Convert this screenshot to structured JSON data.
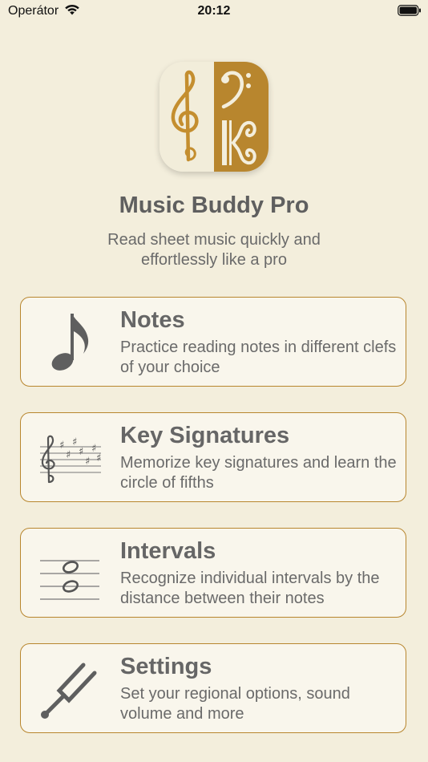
{
  "status_bar": {
    "carrier": "Operátor",
    "time": "20:12"
  },
  "app": {
    "title": "Music Buddy Pro",
    "subtitle": "Read sheet music quickly and effortlessly like a pro"
  },
  "menu": [
    {
      "title": "Notes",
      "description": "Practice reading notes in different clefs of your choice",
      "icon": "eighth-note-icon"
    },
    {
      "title": "Key Signatures",
      "description": "Memorize key signatures and learn the circle of fifths",
      "icon": "key-signature-staff-icon"
    },
    {
      "title": "Intervals",
      "description": "Recognize individual intervals by the distance between their notes",
      "icon": "interval-staff-icon"
    },
    {
      "title": "Settings",
      "description": "Set your regional options, sound volume and more",
      "icon": "tuning-fork-icon"
    }
  ],
  "colors": {
    "background": "#f3eedc",
    "accent": "#b8862e",
    "card": "#f9f6ec",
    "text": "#666666"
  }
}
